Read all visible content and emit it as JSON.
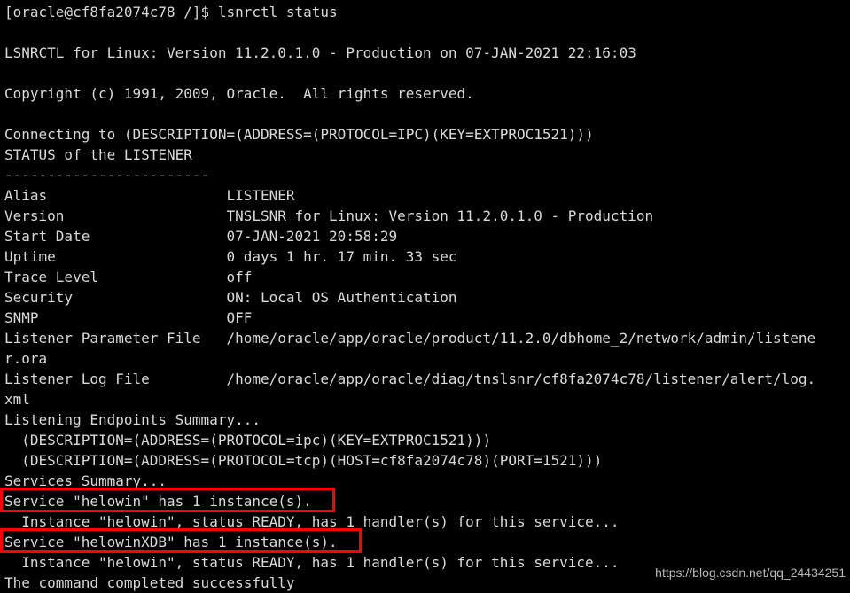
{
  "terminal": {
    "background_color": "#000000",
    "text_color": "#d9d9d9",
    "highlight_color": "#ff0000",
    "prompt_line": "[oracle@cf8fa2074c78 /]$ lsnrctl status",
    "lines": [
      "[oracle@cf8fa2074c78 /]$ lsnrctl status",
      "",
      "LSNRCTL for Linux: Version 11.2.0.1.0 - Production on 07-JAN-2021 22:16:03",
      "",
      "Copyright (c) 1991, 2009, Oracle.  All rights reserved.",
      "",
      "Connecting to (DESCRIPTION=(ADDRESS=(PROTOCOL=IPC)(KEY=EXTPROC1521)))",
      "STATUS of the LISTENER",
      "------------------------",
      "Alias                     LISTENER",
      "Version                   TNSLSNR for Linux: Version 11.2.0.1.0 - Production",
      "Start Date                07-JAN-2021 20:58:29",
      "Uptime                    0 days 1 hr. 17 min. 33 sec",
      "Trace Level               off",
      "Security                  ON: Local OS Authentication",
      "SNMP                      OFF",
      "Listener Parameter File   /home/oracle/app/oracle/product/11.2.0/dbhome_2/network/admin/listene",
      "r.ora",
      "Listener Log File         /home/oracle/app/oracle/diag/tnslsnr/cf8fa2074c78/listener/alert/log.",
      "xml",
      "Listening Endpoints Summary...",
      "  (DESCRIPTION=(ADDRESS=(PROTOCOL=ipc)(KEY=EXTPROC1521)))",
      "  (DESCRIPTION=(ADDRESS=(PROTOCOL=tcp)(HOST=cf8fa2074c78)(PORT=1521)))",
      "Services Summary...",
      "Service \"helowin\" has 1 instance(s).",
      "  Instance \"helowin\", status READY, has 1 handler(s) for this service...",
      "Service \"helowinXDB\" has 1 instance(s).",
      "  Instance \"helowin\", status READY, has 1 handler(s) for this service...",
      "The command completed successfully"
    ],
    "status_fields": [
      {
        "label": "Alias",
        "value": "LISTENER"
      },
      {
        "label": "Version",
        "value": "TNSLSNR for Linux: Version 11.2.0.1.0 - Production"
      },
      {
        "label": "Start Date",
        "value": "07-JAN-2021 20:58:29"
      },
      {
        "label": "Uptime",
        "value": "0 days 1 hr. 17 min. 33 sec"
      },
      {
        "label": "Trace Level",
        "value": "off"
      },
      {
        "label": "Security",
        "value": "ON: Local OS Authentication"
      },
      {
        "label": "SNMP",
        "value": "OFF"
      },
      {
        "label": "Listener Parameter File",
        "value": "/home/oracle/app/oracle/product/11.2.0/dbhome_2/network/admin/listener.ora"
      },
      {
        "label": "Listener Log File",
        "value": "/home/oracle/app/oracle/diag/tnslsnr/cf8fa2074c78/listener/alert/log.xml"
      }
    ],
    "services": [
      {
        "name": "helowin",
        "instances": "1",
        "highlighted": true
      },
      {
        "name": "helowinXDB",
        "instances": "1",
        "highlighted": true
      }
    ]
  },
  "watermark": {
    "text": "https://blog.csdn.net/qq_24434251"
  }
}
